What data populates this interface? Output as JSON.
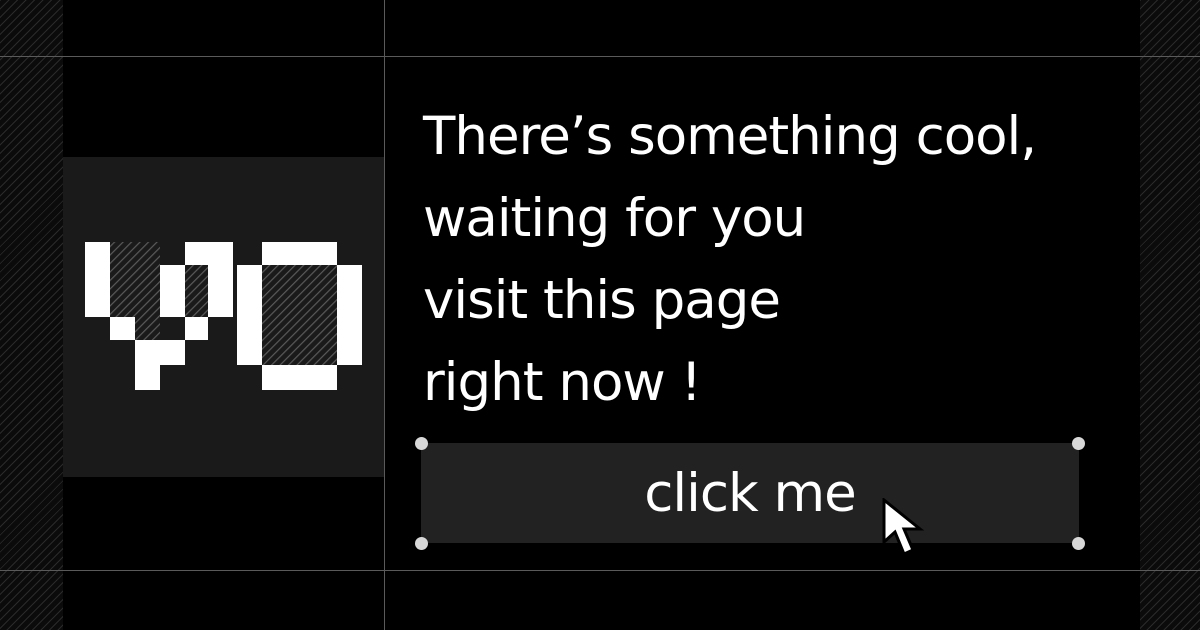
{
  "logo": {
    "letters": "VO"
  },
  "headline": {
    "lines": [
      "There’s something cool,",
      "waiting for you",
      "visit this page",
      "right now !"
    ]
  },
  "cta": {
    "label": "click me"
  },
  "icons": {
    "cursor": "arrow-cursor-icon",
    "handles": "selection-handle-icon"
  },
  "colors": {
    "background": "#000000",
    "panel": "#1a1a1a",
    "button": "#222222",
    "text": "#ffffff",
    "gridline": "#5a5a5a"
  }
}
